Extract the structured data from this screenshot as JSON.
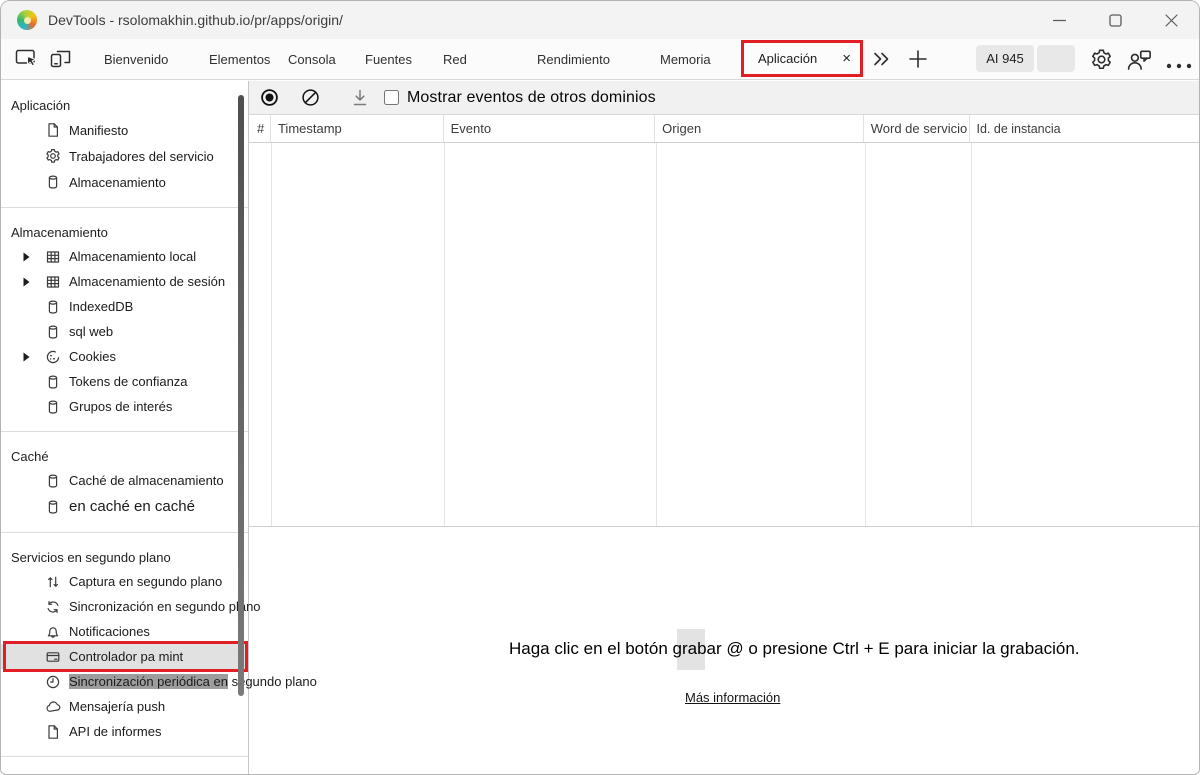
{
  "window": {
    "title": "DevTools - rsolomakhin.github.io/pr/apps/origin/",
    "controls": [
      "minimize-icon",
      "maximize-icon",
      "close-icon"
    ]
  },
  "tabbar": {
    "left_icons": [
      "inspect-icon",
      "device-toolbar-icon"
    ],
    "tabs": [
      "Bienvenido",
      "Elementos",
      "Consola",
      "Fuentes",
      "Red",
      "Rendimiento",
      "Memoria"
    ],
    "active_tab": {
      "label": "Aplicación",
      "close_glyph": "×"
    },
    "overflow_icon": "chevron-double-icon",
    "add_icon": "plus-icon",
    "ai_badge": "AI 945",
    "right_icons": [
      "gear-icon",
      "feedback-icon",
      "more-dots-icon"
    ]
  },
  "toolbar": {
    "icons": [
      "record-icon",
      "clear-icon",
      "download-icon"
    ],
    "checkbox_checked": false,
    "show_events_label": "Mostrar eventos de otros dominios"
  },
  "table": {
    "columns": [
      "#",
      "Timestamp",
      "Evento",
      "Origen",
      "Word de servicio",
      "Id. de instancia"
    ],
    "rows": []
  },
  "sidebar": {
    "sections": [
      {
        "header": "Aplicación",
        "items": [
          {
            "icon": "document",
            "label": "Manifiesto"
          },
          {
            "icon": "gear",
            "label": "Trabajadores del servicio"
          },
          {
            "icon": "database",
            "label": "Almacenamiento"
          }
        ]
      },
      {
        "header": "Almacenamiento",
        "items": [
          {
            "icon": "grid",
            "label": "Almacenamiento local",
            "expandable": true
          },
          {
            "icon": "grid",
            "label": "Almacenamiento de sesión",
            "expandable": true
          },
          {
            "icon": "database",
            "label": "IndexedDB"
          },
          {
            "icon": "database",
            "label": "sql web"
          },
          {
            "icon": "cookie",
            "label": "Cookies",
            "expandable": true
          },
          {
            "icon": "database",
            "label": "Tokens de confianza"
          },
          {
            "icon": "database",
            "label": "Grupos de interés"
          }
        ]
      },
      {
        "header": "Caché",
        "items": [
          {
            "icon": "database",
            "label": "Caché de almacenamiento"
          },
          {
            "icon": "database",
            "label": "en caché en caché",
            "large": true
          }
        ]
      },
      {
        "header": "Servicios en segundo plano",
        "items": [
          {
            "icon": "updown",
            "label": "Captura en segundo plano"
          },
          {
            "icon": "sync",
            "label": "Sincronización en segundo plano"
          },
          {
            "icon": "bell",
            "label": "Notificaciones"
          },
          {
            "icon": "card",
            "label": "Controlador pa mint",
            "selected": true,
            "red_outline": true
          },
          {
            "icon": "clock",
            "label": "Sincronización periódica en segundo plano",
            "selection_text": "Sincronización periódica en"
          },
          {
            "icon": "cloud",
            "label": "Mensajería push"
          },
          {
            "icon": "document",
            "label": "API de informes"
          }
        ]
      }
    ]
  },
  "empty_state": {
    "message": "Haga clic en el botón grabar @ o presione Ctrl + E para iniciar la grabación.",
    "link": "Más información"
  },
  "colors": {
    "annotation_red": "#e01e24",
    "selected_item_bg": "#e1e1e1",
    "text_selection_bg": "#9d9d9d",
    "toolbar_bg": "#f1f1f1",
    "titlebar_bg": "#f3f3f3"
  }
}
